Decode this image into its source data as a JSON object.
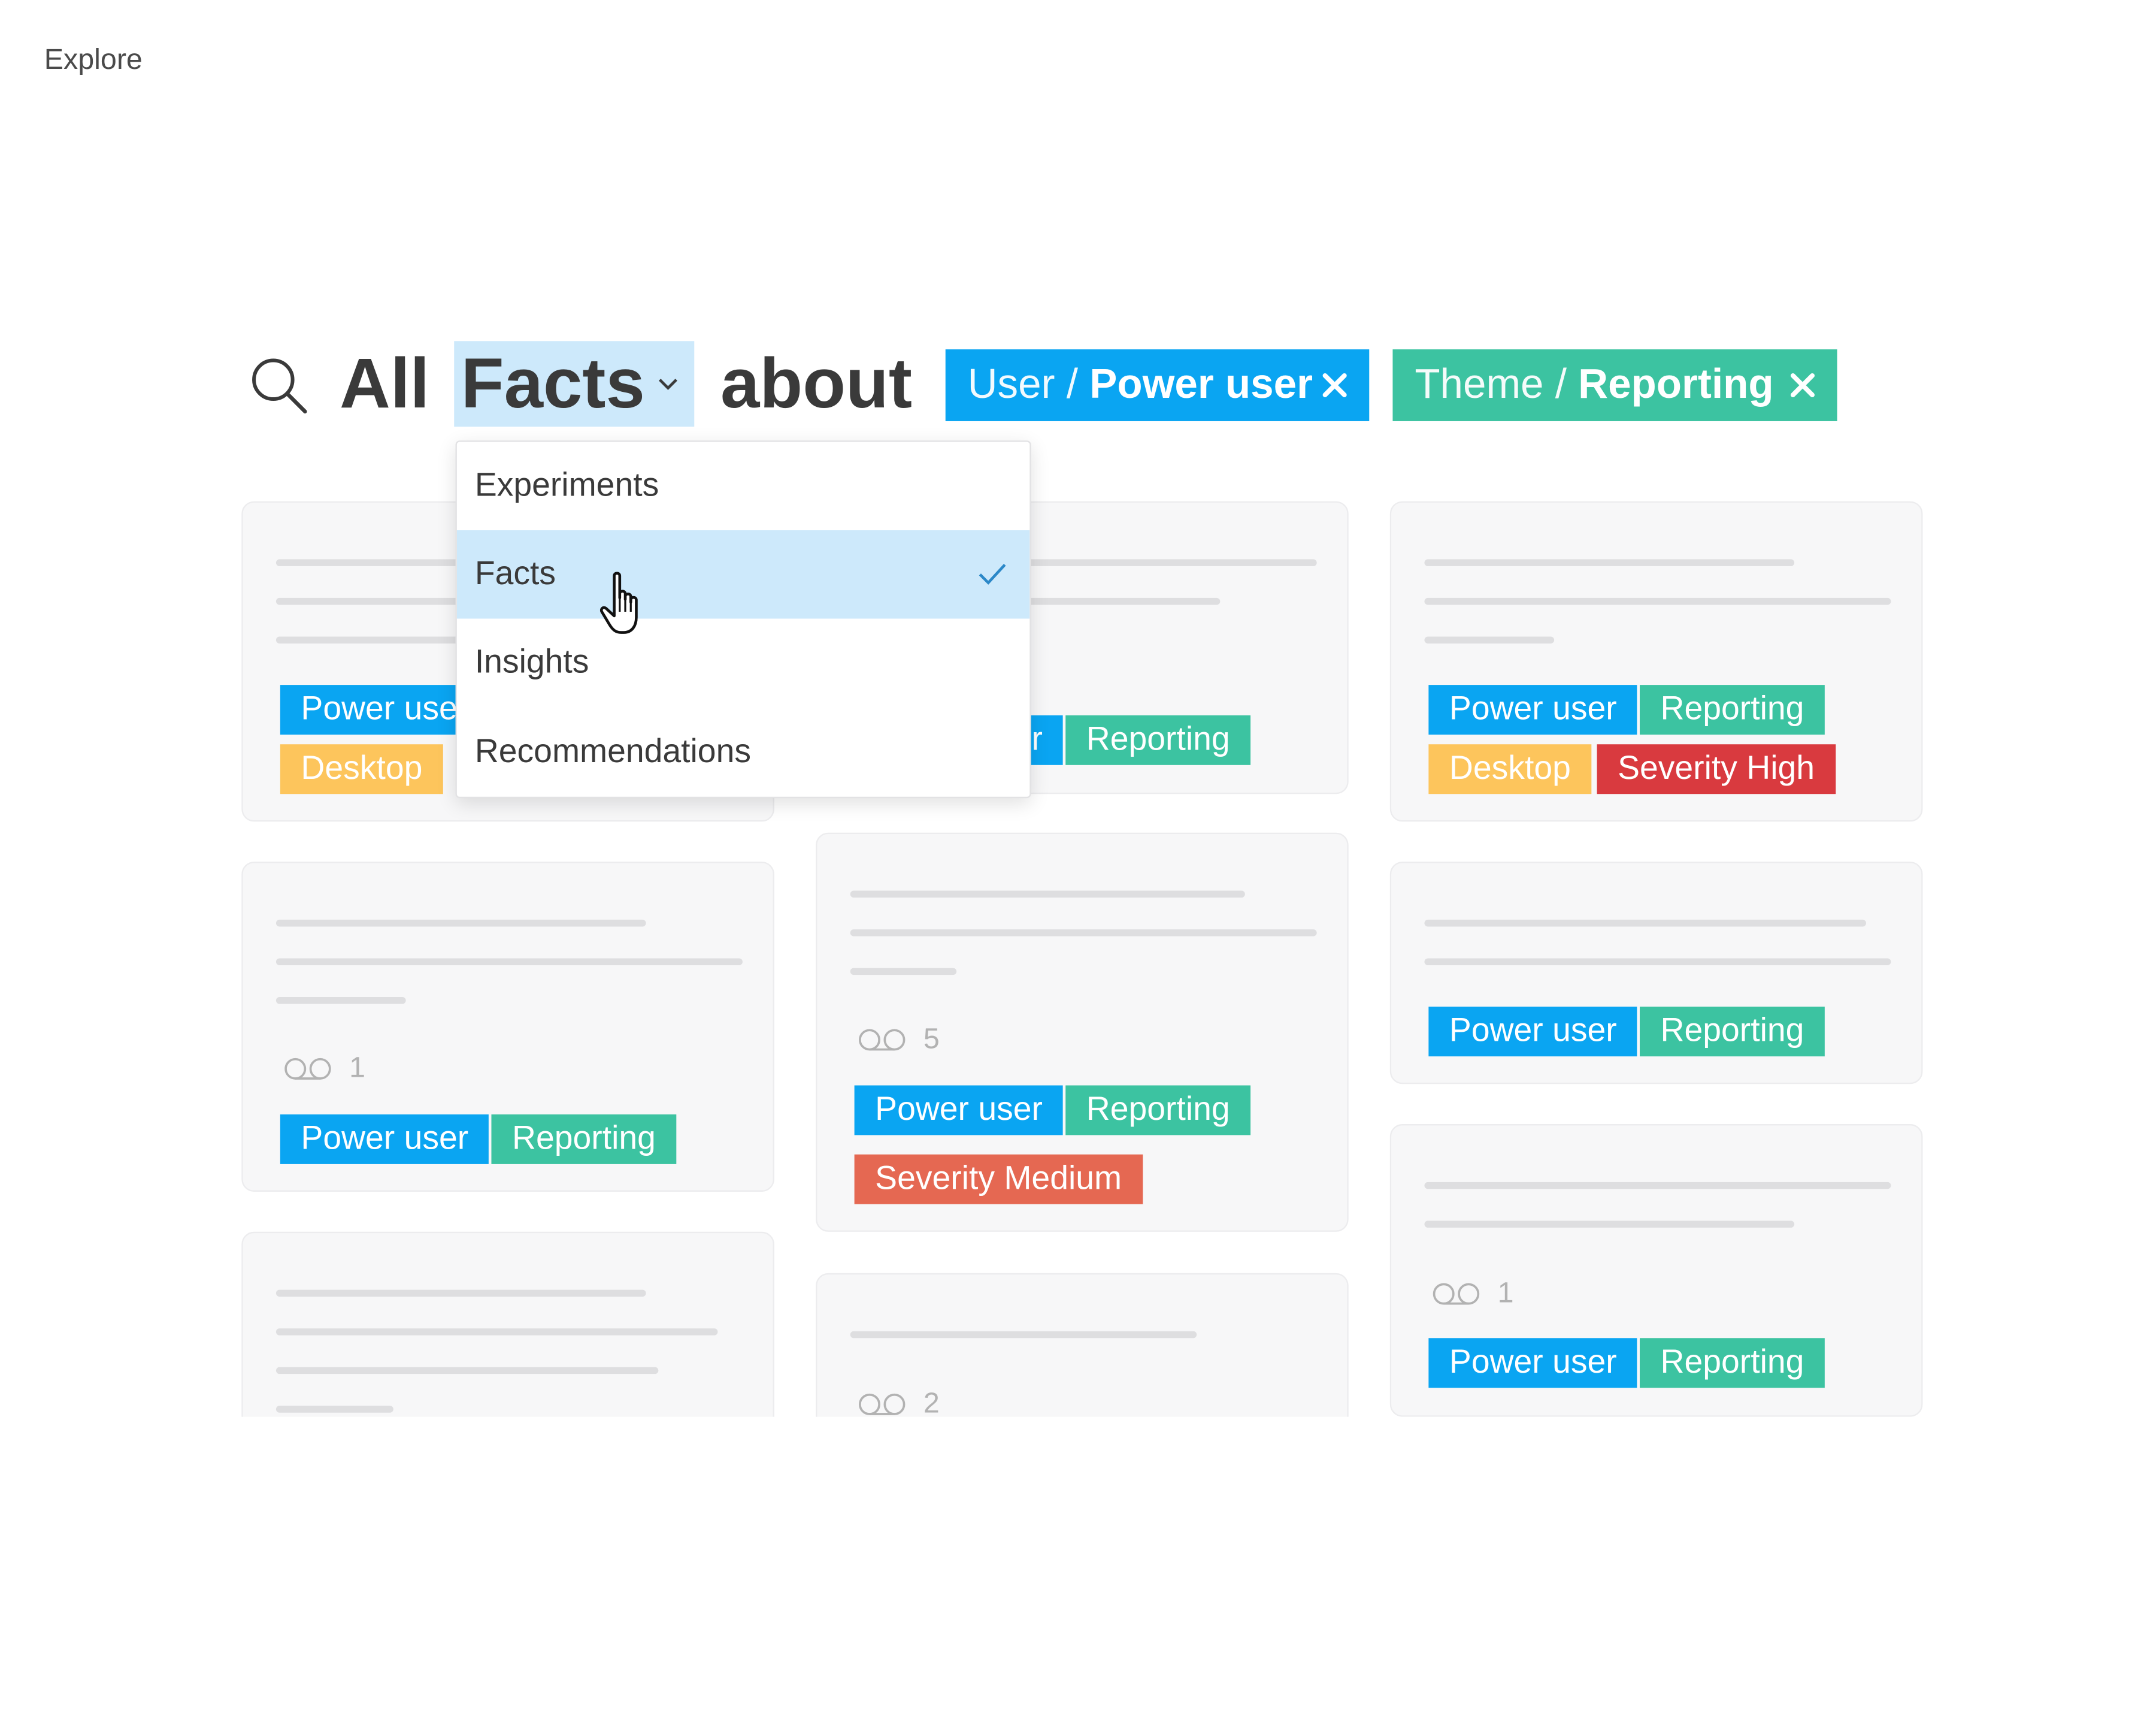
{
  "page": {
    "label": "Explore"
  },
  "query": {
    "prefix": "All",
    "type_selected": "Facts",
    "connector": "about",
    "filters": [
      {
        "category": "User",
        "separator": " / ",
        "value": "Power user",
        "color": "#0aa5f2"
      },
      {
        "category": "Theme",
        "separator": " / ",
        "value": "Reporting",
        "color": "#3cc3a1"
      }
    ]
  },
  "dropdown": {
    "options": [
      "Experiments",
      "Facts",
      "Insights",
      "Recommendations"
    ],
    "selected": "Facts"
  },
  "tag_labels": {
    "power_user": "Power user",
    "reporting": "Reporting",
    "desktop": "Desktop",
    "severity_high": "Severity High",
    "severity_medium": "Severity Medium"
  },
  "tag_colors": {
    "power_user": "#0aa5f2",
    "reporting": "#3cc3a1",
    "desktop": "#fdc55c",
    "severity_high": "#d93a3f",
    "severity_medium": "#e56852"
  },
  "cards": {
    "col1_row2_count": "1",
    "col2_row2_count": "5",
    "col2_row3_count": "2",
    "col3_row4_count": "1"
  }
}
